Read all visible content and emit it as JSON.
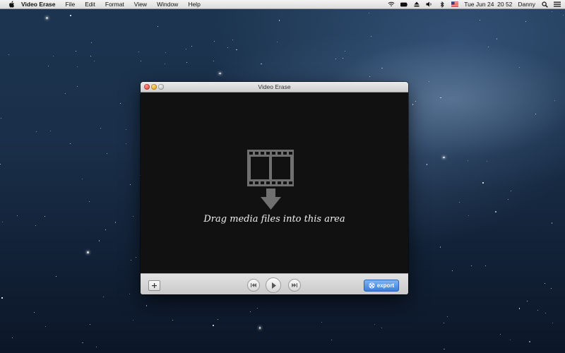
{
  "menubar": {
    "app_name": "Video Erase",
    "items": [
      "File",
      "Edit",
      "Format",
      "View",
      "Window",
      "Help"
    ],
    "clock": "Tue Jun 24  20 52",
    "user": "Danny",
    "status_icons": [
      "wifi-icon",
      "battery-icon",
      "eject-icon",
      "volume-icon",
      "bluetooth-icon",
      "flag-icon",
      "spotlight-icon",
      "list-icon"
    ]
  },
  "window": {
    "title": "Video Erase",
    "drop_text": "Drag media files into this area",
    "export_label": "export"
  },
  "colors": {
    "export_button": "#3a7fd8",
    "dropzone_bg": "#111111",
    "icon_gray": "#6f6f6f"
  }
}
